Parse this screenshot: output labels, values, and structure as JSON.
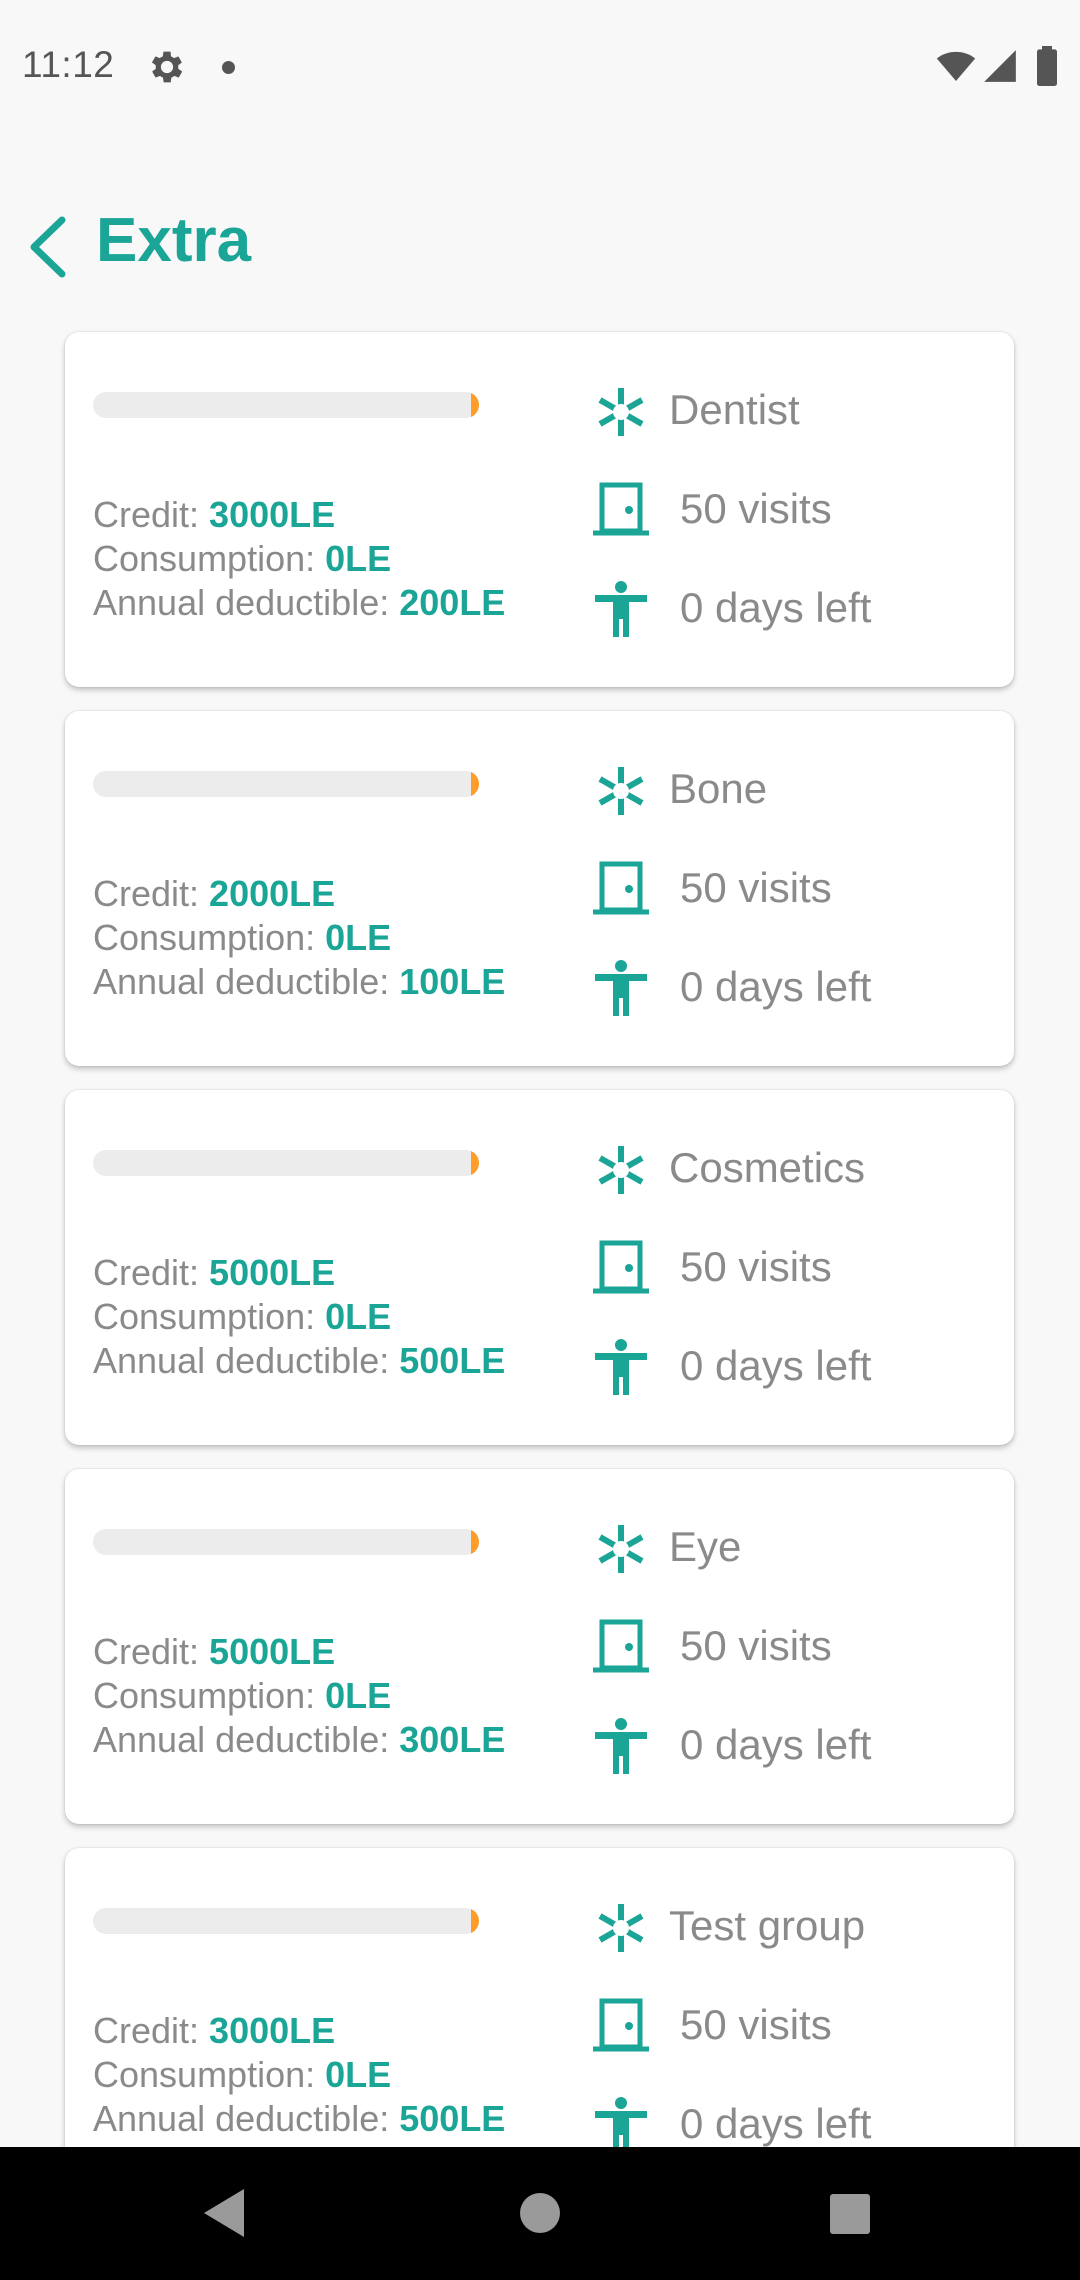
{
  "status_bar": {
    "time": "11:12",
    "icons": [
      "settings-gear-icon",
      "notification-dot-icon",
      "wifi-icon",
      "cell-signal-icon",
      "battery-icon"
    ]
  },
  "app_bar": {
    "title": "Extra",
    "back_icon": "chevron-left-icon"
  },
  "colors": {
    "accent": "#1aa596",
    "progress_fill": "#ff9c2a",
    "progress_track": "#ececec",
    "label_text": "#8a8a8a",
    "background": "#f8f8f8"
  },
  "labels": {
    "credit": "Credit:",
    "consumption": "Consumption:",
    "deductible": "Annual deductible:"
  },
  "cards": [
    {
      "category": "Dentist",
      "credit": "3000LE",
      "consumption": "0LE",
      "deductible": "200LE",
      "visits": "50 visits",
      "days_left": "0 days left",
      "progress": 0.02
    },
    {
      "category": "Bone",
      "credit": "2000LE",
      "consumption": "0LE",
      "deductible": "100LE",
      "visits": "50 visits",
      "days_left": "0 days left",
      "progress": 0.02
    },
    {
      "category": "Cosmetics",
      "credit": "5000LE",
      "consumption": "0LE",
      "deductible": "500LE",
      "visits": "50 visits",
      "days_left": "0 days left",
      "progress": 0.02
    },
    {
      "category": "Eye",
      "credit": "5000LE",
      "consumption": "0LE",
      "deductible": "300LE",
      "visits": "50 visits",
      "days_left": "0 days left",
      "progress": 0.02
    },
    {
      "category": "Test group",
      "credit": "3000LE",
      "consumption": "0LE",
      "deductible": "500LE",
      "visits": "50 visits",
      "days_left": "0 days left",
      "progress": 0.02
    }
  ],
  "card_icons": [
    "medical-star-icon",
    "door-icon",
    "person-icon"
  ],
  "nav_bar": {
    "icons": [
      "nav-back-icon",
      "nav-home-icon",
      "nav-recents-icon"
    ]
  }
}
